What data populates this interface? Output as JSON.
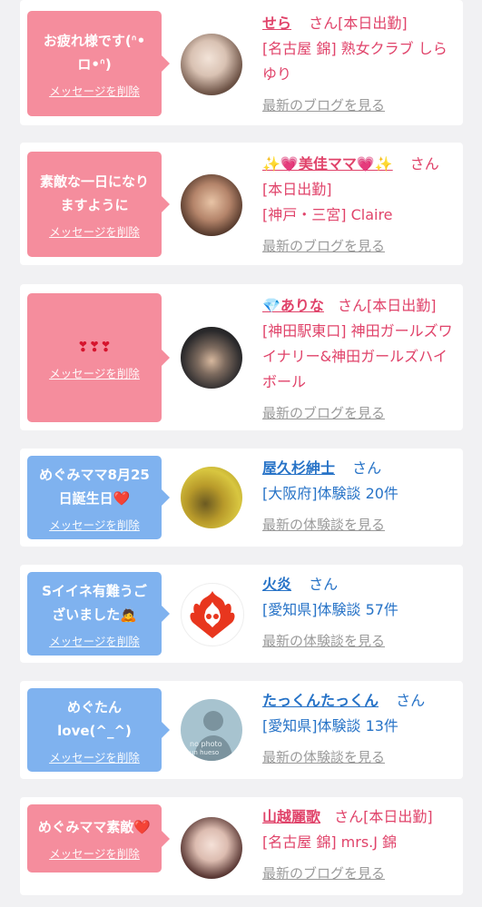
{
  "items": [
    {
      "message": "お疲れ様です(ˊ̥̥̥̥̥ ⌑ ˋ̥̥̥̥̥)",
      "message_line1": "お疲れ様です(ᐢ•",
      "message_line2": "ロ•ᐢ)",
      "delete_label": "メッセージを削除",
      "name": "せら",
      "san": "さん[本日出勤]",
      "detail": "[名古屋 錦] 熟女クラブ しらゆり",
      "link": "最新のブログを見る",
      "theme": "pink"
    },
    {
      "message_line1": "素敵な一日になり",
      "message_line2": "ますように",
      "delete_label": "メッセージを削除",
      "name": "✨💗美佳ママ💗✨",
      "san": "さん",
      "detail1": "[本日出勤]",
      "detail2": "[神戸・三宮] Claire",
      "link": "最新のブログを見る",
      "theme": "pink"
    },
    {
      "message_line1": "❣❣❣",
      "delete_label": "メッセージを削除",
      "name": "💎ありな",
      "san": "さん[本日出勤]",
      "detail": "[神田駅東口] 神田ガールズワイナリー&神田ガールズハイボール",
      "link": "最新のブログを見る",
      "theme": "pink"
    },
    {
      "message_line1": "めぐみママ8月25",
      "message_line2": "日誕生日❤️",
      "delete_label": "メッセージを削除",
      "name": "屋久杉紳士",
      "san": "さん",
      "detail": "[大阪府]体験談 20件",
      "link": "最新の体験談を見る",
      "theme": "blue"
    },
    {
      "message_line1": "Sイイネ有難うご",
      "message_line2": "ざいました🙇",
      "delete_label": "メッセージを削除",
      "name": "火炎",
      "san": "さん",
      "detail": "[愛知県]体験談 57件",
      "link": "最新の体験談を見る",
      "theme": "blue"
    },
    {
      "message_line1": "めぐたん",
      "message_line2": "love(^_^)",
      "delete_label": "メッセージを削除",
      "name": "たっくんたっくん",
      "san": "さん",
      "detail": "[愛知県]体験談 13件",
      "link": "最新の体験談を見る",
      "theme": "blue",
      "avatar_text1": "no photo",
      "avatar_text2": "un hueso"
    },
    {
      "message_line1": "めぐみママ素敵❤️",
      "delete_label": "メッセージを削除",
      "name": "山越麗歌",
      "san": "さん[本日出勤]",
      "detail": "[名古屋 錦] mrs.J 錦",
      "link": "最新のブログを見る",
      "theme": "pink"
    }
  ]
}
